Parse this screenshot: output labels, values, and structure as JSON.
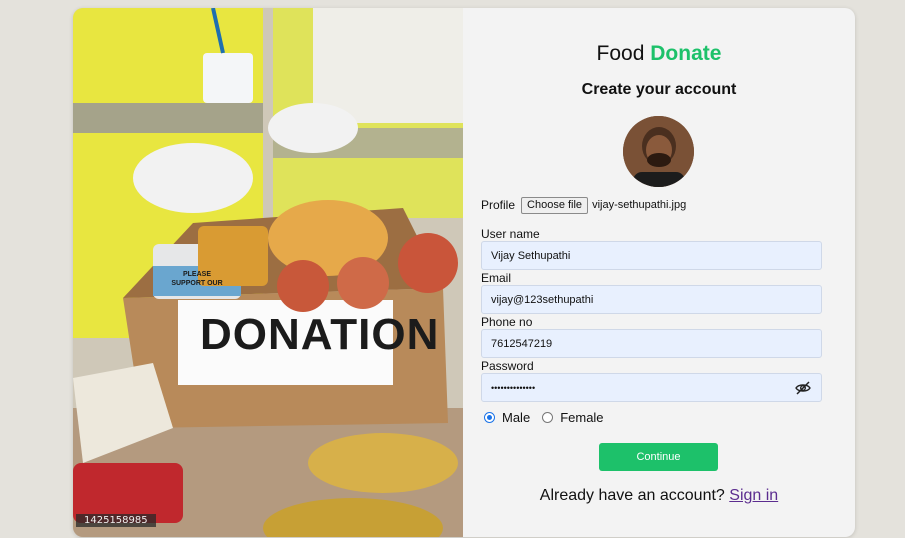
{
  "photo": {
    "id_watermark": "1425158985",
    "box_label": "DONATION",
    "can_label": "PLEASE SUPPORT OUR"
  },
  "form": {
    "brand_first": "Food",
    "brand_second": "Donate",
    "title": "Create your account",
    "profile_label": "Profile",
    "file_button": "Choose file",
    "file_name": "vijay-sethupathi.jpg",
    "username_label": "User name",
    "username_value": "Vijay Sethupathi",
    "email_label": "Email",
    "email_value": "vijay@123sethupathi",
    "phone_label": "Phone no",
    "phone_value": "7612547219",
    "password_label": "Password",
    "password_value": "••••••••••••••",
    "gender_options": [
      "Male",
      "Female"
    ],
    "gender_selected": "Male",
    "continue_label": "Continue",
    "have_account_text": "Already have an account?",
    "signin_label": "Sign in"
  },
  "colors": {
    "accent": "#1dc16a",
    "input_bg": "#e8f0fe",
    "link": "#5b2c8f"
  }
}
